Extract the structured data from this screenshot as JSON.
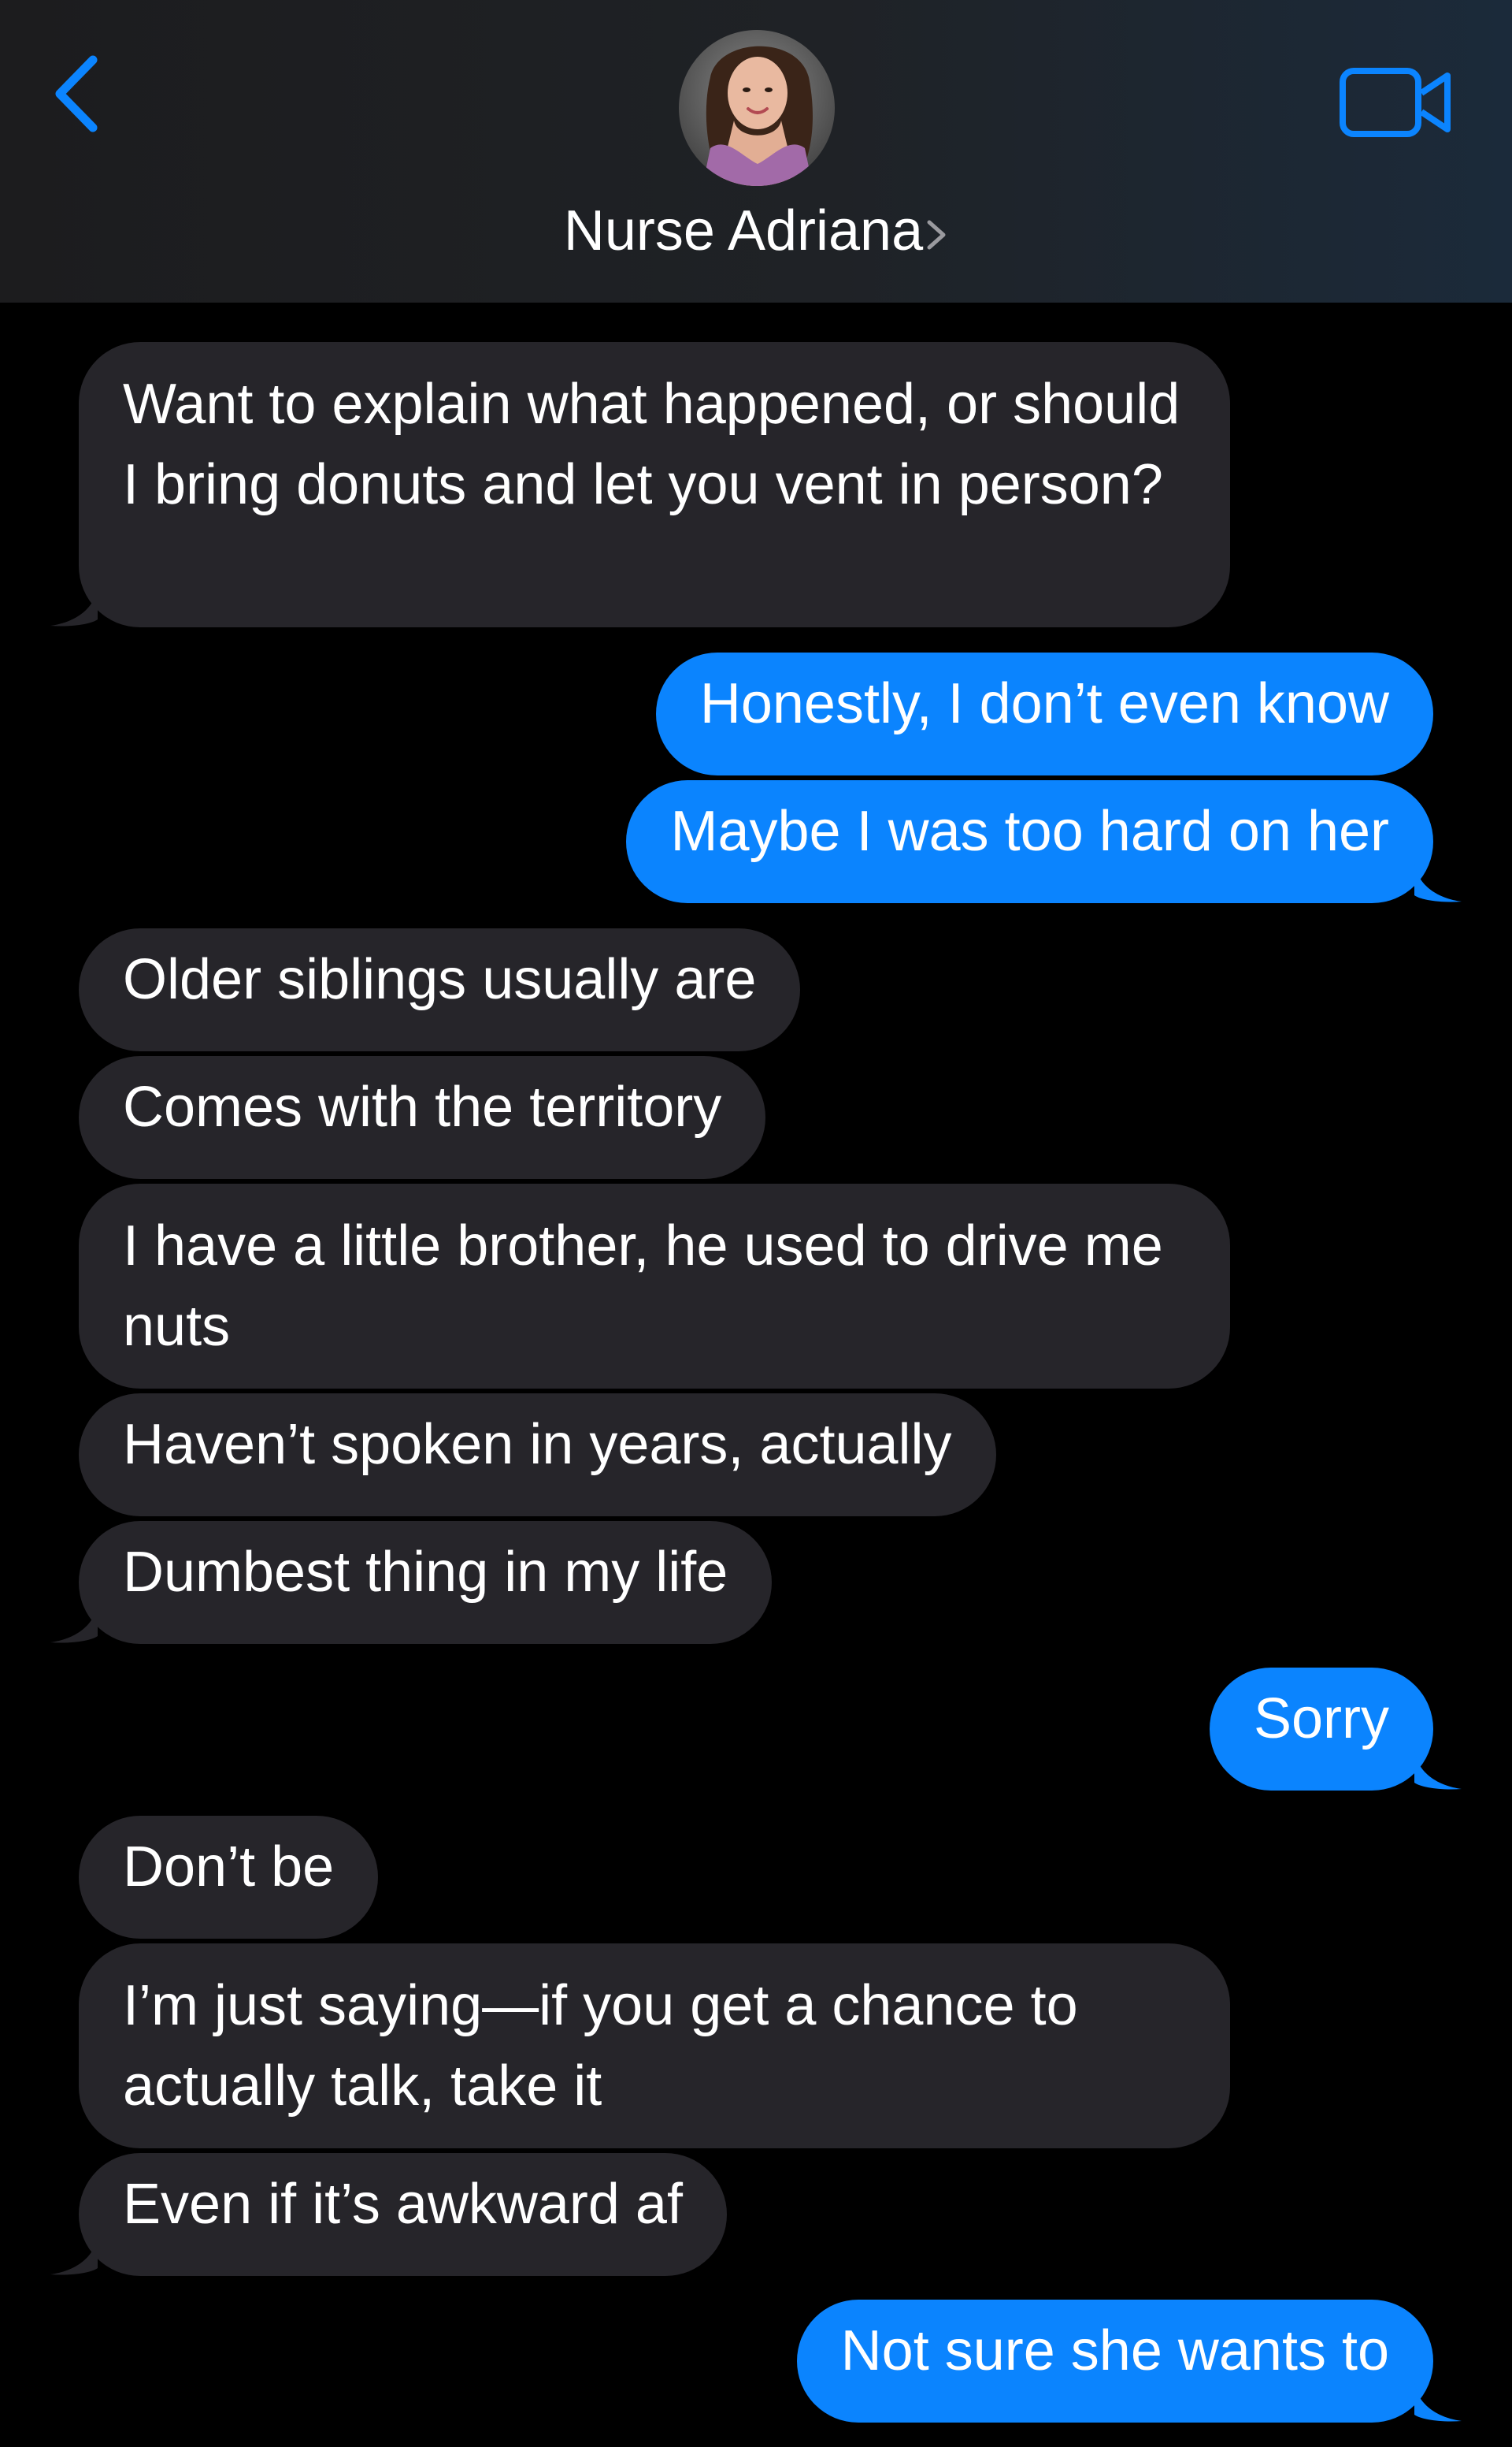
{
  "header": {
    "contact_name": "Nurse Adriana",
    "avatar_label": "contact-photo",
    "back_icon": "chevron-left-icon",
    "video_icon": "video-camera-icon",
    "accent_color": "#0b84fe"
  },
  "messages": [
    {
      "from": "contact",
      "text": "Want to explain what happened, or should I bring donuts and let you vent in person?"
    },
    {
      "from": "me",
      "text": "Honestly, I don’t even know"
    },
    {
      "from": "me",
      "text": "Maybe I was too hard on her"
    },
    {
      "from": "contact",
      "text": "Older siblings usually are"
    },
    {
      "from": "contact",
      "text": "Comes with the territory"
    },
    {
      "from": "contact",
      "text": "I have a little brother, he used to drive me nuts"
    },
    {
      "from": "contact",
      "text": "Haven’t spoken in years, actually"
    },
    {
      "from": "contact",
      "text": "Dumbest thing in my life"
    },
    {
      "from": "me",
      "text": "Sorry"
    },
    {
      "from": "contact",
      "text": "Don’t be"
    },
    {
      "from": "contact",
      "text": "I’m just saying—if you get a chance to actually talk, take it"
    },
    {
      "from": "contact",
      "text": "Even if it’s awkward af"
    },
    {
      "from": "me",
      "text": "Not sure she wants to"
    }
  ],
  "colors": {
    "incoming_bubble": "#26252a",
    "outgoing_bubble": "#0b84fe",
    "background": "#000000"
  }
}
